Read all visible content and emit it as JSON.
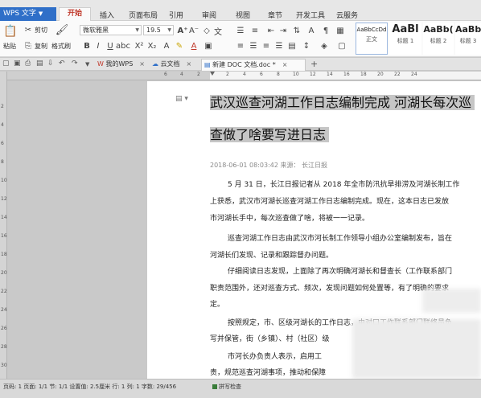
{
  "app": {
    "button_label": "WPS 文字"
  },
  "menu": {
    "tabs": [
      "开始",
      "插入",
      "页面布局",
      "引用",
      "审阅",
      "视图",
      "章节",
      "开发工具",
      "云服务"
    ],
    "active_tab": "开始"
  },
  "ribbon": {
    "paste_label": "粘贴",
    "cut_label": "剪切",
    "copy_label": "复制",
    "format_painter_label": "格式刷",
    "font_name": "微软雅黑",
    "font_size": "19.5",
    "styles": [
      {
        "sample": "AaBbCcDd",
        "label": "正文"
      },
      {
        "sample": "AaBl",
        "label": "标题 1"
      },
      {
        "sample": "AaBb(",
        "label": "标题 2"
      },
      {
        "sample": "AaBb",
        "label": "标题 3"
      }
    ]
  },
  "tabs": {
    "items": [
      {
        "label": "我的WPS",
        "active": false
      },
      {
        "label": "云文档",
        "active": false
      },
      {
        "label": "新建 DOC 文档.doc *",
        "active": true
      }
    ],
    "new_tab": "+"
  },
  "rulers": {
    "h_numbers": [
      "6",
      "4",
      "2",
      "2",
      "4",
      "6",
      "8",
      "10",
      "12",
      "14",
      "16",
      "18",
      "20",
      "22",
      "24"
    ],
    "v_numbers": [
      "2",
      "4",
      "6",
      "8",
      "10",
      "12",
      "14",
      "16",
      "18",
      "20",
      "22",
      "24",
      "26",
      "28",
      "30"
    ]
  },
  "document": {
    "title_line1": "武汉巡查河湖工作日志编制完成  河湖长每次巡",
    "title_line2": "查做了啥要写进日志",
    "meta": "2018-06-01 08:03:42   来源：  长江日报",
    "paragraphs": [
      "5 月 31 日，长江日报记者从 2018 年全市防汛抗旱排涝及河湖长制工作",
      "上获悉，武汉市河湖长巡查河湖工作日志编制完成。现在，这本日志已发放",
      "市河湖长手中，每次巡查做了啥，将被一一记录。",
      "巡查河湖工作日志由武汉市河长制工作领导小组办公室编制发布，旨在",
      "河湖长们发现、记录和跟踪督办问题。",
      "仔细阅读日志发现，上面除了再次明确河湖长和督查长（工作联系部门",
      "职责范围外，还对巡查方式、频次，发现问题如何处置等，有了明确的要求",
      "定。",
      "按照规定，市、区级河湖长的工作日志，由对口工作联系部门联络员负",
      "写并保管，街（乡镇）、村（社区）级",
      "市河长办负责人表示，启用工",
      "责，规范巡查河湖事项，推动和保障"
    ]
  },
  "status": {
    "info": "页码: 1   页面: 1/1   节: 1/1   设置值: 2.5厘米   行: 1   列: 1   字数: 29/456",
    "spell": "拼写检查"
  }
}
